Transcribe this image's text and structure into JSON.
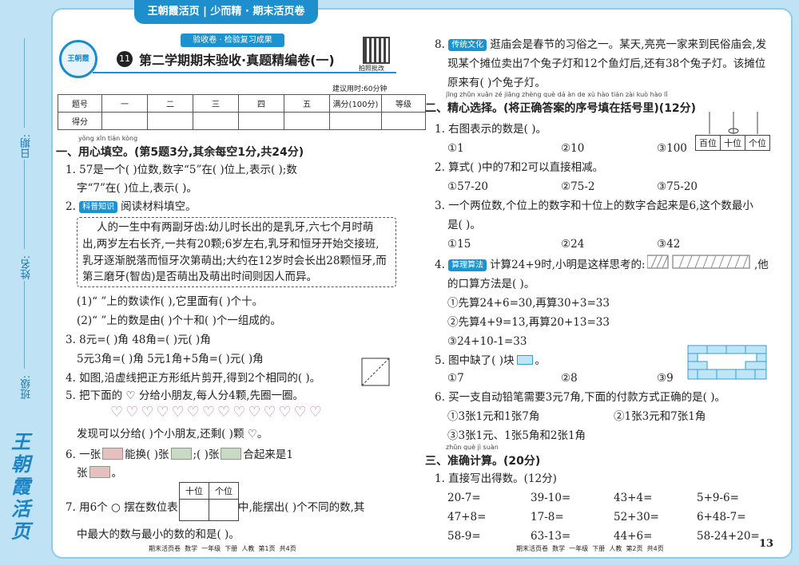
{
  "banner": {
    "brand": "王朝霞活页",
    "series": "少而精 · 期末活页卷"
  },
  "header": {
    "subtitle": "验收卷 · 检验复习成果",
    "number": "11",
    "title": "第二学期期末验收·真题精编卷(一)",
    "qr_caption": "拍照批改",
    "time_hint": "建议用时:60分钟"
  },
  "score_table": {
    "headers": [
      "题号",
      "一",
      "二",
      "三",
      "四",
      "五",
      "满分(100分)",
      "等级"
    ],
    "row_label": "得分"
  },
  "side": {
    "date": "日期:",
    "name": "姓名:",
    "class": "班级:",
    "logo": "王朝霞活页"
  },
  "left": {
    "sec1_pinyin": "yòng xīn tián kòng",
    "sec1": "一、用心填空。(第5题3分,其余每空1分,共24分)",
    "q1a": "1. 57是一个(      )位数,数字“5”在(      )位上,表示(      );数",
    "q1b": "字“7”在(      )位上,表示(      )。",
    "q2_tag": "科普知识",
    "q2": "阅读材料填空。",
    "box": [
      "人的一生中有两副牙齿:幼儿时长出的是乳牙,六七个月时萌",
      "出,两岁左右长齐,一共有20颗;6岁左右,乳牙和恒牙开始交接班,",
      "乳牙逐渐脱落而恒牙次第萌出;大约在12岁时会长出28颗恒牙,而",
      "第三磨牙(智齿)是否萌出及萌出时间则因人而异。"
    ],
    "q2_1": "(1)“       ”上的数读作(      ),它里面有(      )个十。",
    "q2_2": "(2)“       ”上的数是由(      )个十和(      )个一组成的。",
    "q3a": "3. 8元=(      )角          48角=(      )元(      )角",
    "q3b": "5元3角=(      )角          5元1角+5角=(      )元(      )角",
    "q4": "4. 如图,沿虚线把正方形纸片剪开,得到2个相同的(      )。",
    "q5": "5. 把下面的 ♡ 分给小朋友,每人分4颗,先圈一圈。",
    "hearts": "♡♡♡♡♡♡♡♡♡♡♡♡♡♡",
    "q5b": "发现可以分给(      )个小朋友,还剩(      )颗 ♡。",
    "q6a_1": "6. 一张",
    "q6a_2": "能换(      )张",
    "q6a_3": ";(      )张",
    "q6a_4": "合起来是1",
    "q6b_1": "张",
    "q6b_2": "。",
    "q7a_1": "7. 用6个 ○ 摆在数位表",
    "q7a_2": "中,能摆出(      )个不同的数,其",
    "q7b": "中最大的数与最小的数的和是(      )。",
    "pv_tens": "十位",
    "pv_ones": "个位",
    "footer": "期末活页卷  数学  一年级  下册  人教  第1页  共4页"
  },
  "right": {
    "q8_tag": "传统文化",
    "q8a": "逛庙会是春节的习俗之一。某天,亮亮一家来到民俗庙会,发",
    "q8b": "现某个摊位卖出7个兔子灯和12个鱼灯后,还有38个兔子灯。该摊位",
    "q8c": "原来有(      )个兔子灯。",
    "q8_num": "8.",
    "sec2_pinyin": "jīng zhǔn xuǎn zé           jiāng zhèng què dá àn de xù hào tián zài kuò hào lǐ",
    "sec2": "二、精心选择。(将正确答案的序号填在括号里)(12分)",
    "s1": "1. 右图表示的数是(      )。",
    "s1_opts": [
      "①1",
      "②10",
      "③100"
    ],
    "s1_cols": [
      "百位",
      "十位",
      "个位"
    ],
    "s2": "2. 算式(      )中的7和2可以直接相减。",
    "s2_opts": [
      "①57-20",
      "②75-2",
      "③75-20"
    ],
    "s3a": "3. 一个两位数,个位上的数字和十位上的数字合起来是6,这个数最小",
    "s3b": "是(      )。",
    "s3_opts": [
      "①15",
      "②24",
      "③42"
    ],
    "s4_tag": "算理算法",
    "s4a": "计算24+9时,小明是这样思考的:",
    "s4a_end": ",他",
    "s4b": "的口算方法是(      )。",
    "s4_opts": [
      "①先算24+6=30,再算30+3=33",
      "②先算4+9=13,再算20+13=33",
      "③24+10-1=33"
    ],
    "s5": "5. 图中缺了(      )块",
    "s5_end": "。",
    "s5_opts": [
      "①7",
      "②8",
      "③9"
    ],
    "s6": "6. 买一支自动铅笔需要3元7角,下面的付款方式正确的是(      )。",
    "s6_opts": [
      "①3张1元和1张7角",
      "②1张3元和7张1角",
      "③3张1元、1张5角和2张1角"
    ],
    "sec3_pinyin": "zhǔn què  jì  suàn",
    "sec3": "三、准确计算。(20分)",
    "c1": "1. 直接写出得数。(12分)",
    "calc": [
      [
        "20-7=",
        "39-10=",
        "43+4=",
        "5+9-6="
      ],
      [
        "47+8=",
        "17-8=",
        "52+30=",
        "6+48-7="
      ],
      [
        "58-9=",
        "63-13=",
        "44+6=",
        "58-24+20="
      ]
    ],
    "footer": "期末活页卷  数学  一年级  下册  人教  第2页  共4页",
    "page_no": "13"
  }
}
